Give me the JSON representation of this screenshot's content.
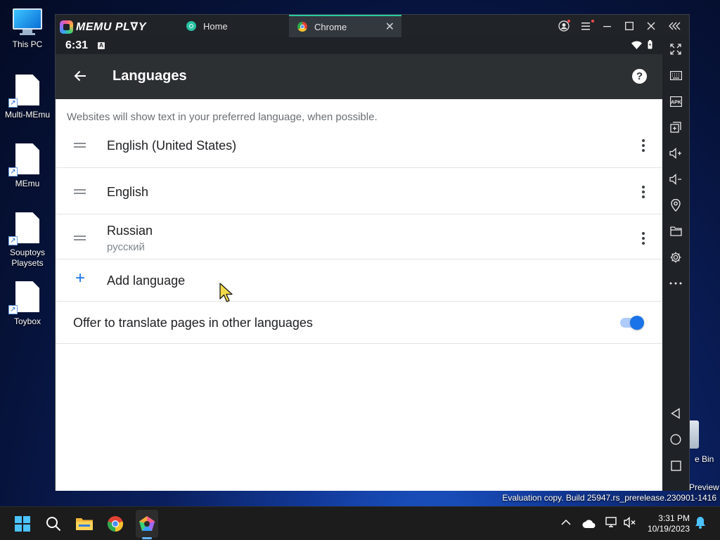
{
  "desktop": {
    "icons": [
      {
        "label": "This PC"
      },
      {
        "label": "Multi-MEmu"
      },
      {
        "label": "MEmu"
      },
      {
        "label": "Souptoys Playsets"
      },
      {
        "label": "Toybox"
      }
    ],
    "recycle_bin_label": "e Bin",
    "preview_label": "Preview",
    "watermark": "Evaluation copy. Build 25947.rs_prerelease.230901-1416"
  },
  "memu": {
    "logo_text": "MEMU PL∇Y",
    "tabs": [
      {
        "label": "Home"
      },
      {
        "label": "Chrome",
        "close": "✕"
      }
    ]
  },
  "android": {
    "status_time": "6:31",
    "status_badge": "A",
    "page_title": "Languages",
    "help_glyph": "?",
    "description": "Websites will show text in your preferred language, when possible.",
    "languages": [
      {
        "name": "English (United States)",
        "native": ""
      },
      {
        "name": "English",
        "native": ""
      },
      {
        "name": "Russian",
        "native": "русский"
      }
    ],
    "add_language_label": "Add language",
    "add_icon": "+",
    "offer_translate_label": "Offer to translate pages in other languages",
    "offer_translate_enabled": true
  },
  "taskbar": {
    "time": "3:31 PM",
    "date": "10/19/2023"
  },
  "colors": {
    "accent_blue": "#1a73e8",
    "appbar": "#2c3033",
    "memu_tab_accent": "#2bc9a5"
  }
}
